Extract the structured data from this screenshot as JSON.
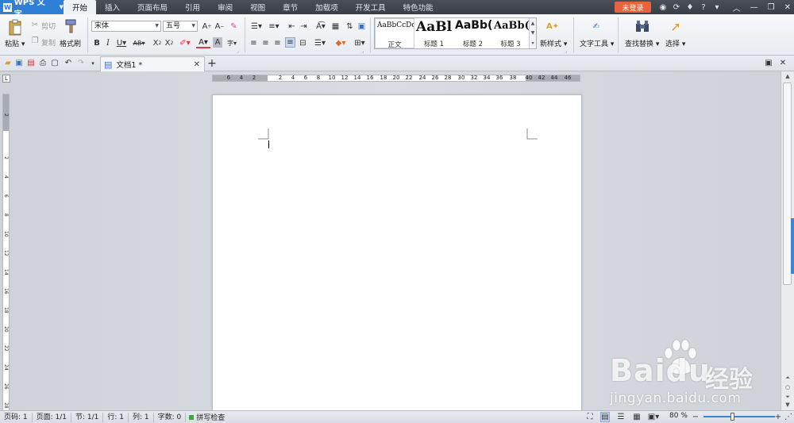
{
  "app": {
    "name": "WPS 文字",
    "logo": "W"
  },
  "menu_tabs": [
    "开始",
    "插入",
    "页面布局",
    "引用",
    "审阅",
    "视图",
    "章节",
    "加载项",
    "开发工具",
    "特色功能"
  ],
  "active_menu_tab": 0,
  "login_label": "未登录",
  "help_label": "?",
  "ribbon": {
    "paste": "粘贴",
    "cut": "剪切",
    "copy": "复制",
    "format_painter": "格式刷",
    "font_name": "宋体",
    "font_size": "五号",
    "styles": [
      {
        "preview": "AaBbCcDd",
        "name": "正文"
      },
      {
        "preview": "AaBl",
        "name": "标题 1"
      },
      {
        "preview": "AaBb(",
        "name": "标题 2"
      },
      {
        "preview": "AaBb(",
        "name": "标题 3"
      }
    ],
    "new_style": "新样式",
    "text_tools": "文字工具",
    "find_replace": "查找替换",
    "select": "选择"
  },
  "document_tab": {
    "title": "文档1 *"
  },
  "ruler": {
    "h_left": [
      "6",
      "4",
      "2"
    ],
    "h_right": [
      "2",
      "4",
      "6",
      "8",
      "10",
      "12",
      "14",
      "16",
      "18",
      "20",
      "22",
      "24",
      "26",
      "28",
      "30",
      "32",
      "34",
      "36",
      "38",
      "40",
      "42",
      "44",
      "46"
    ],
    "v_top": [
      "2"
    ],
    "v_bottom": [
      "2",
      "4",
      "6",
      "8",
      "10",
      "12",
      "14",
      "16",
      "18",
      "20",
      "22",
      "24",
      "26",
      "28"
    ]
  },
  "status": {
    "page_code": "页码: 1",
    "page_count": "页面: 1/1",
    "section": "节: 1/1",
    "row": "行: 1",
    "column": "列: 1",
    "word_count": "字数: 0",
    "spell_check": "拼写检查",
    "zoom": "80 %",
    "zoom_level": 0.4
  },
  "watermark": {
    "brand": "Baidu",
    "cn": "经验",
    "url": "jingyan.baidu.com"
  },
  "colors": {
    "accent": "#2f7fd6",
    "login": "#e8623e",
    "spell_ok": "#3ea43e"
  }
}
